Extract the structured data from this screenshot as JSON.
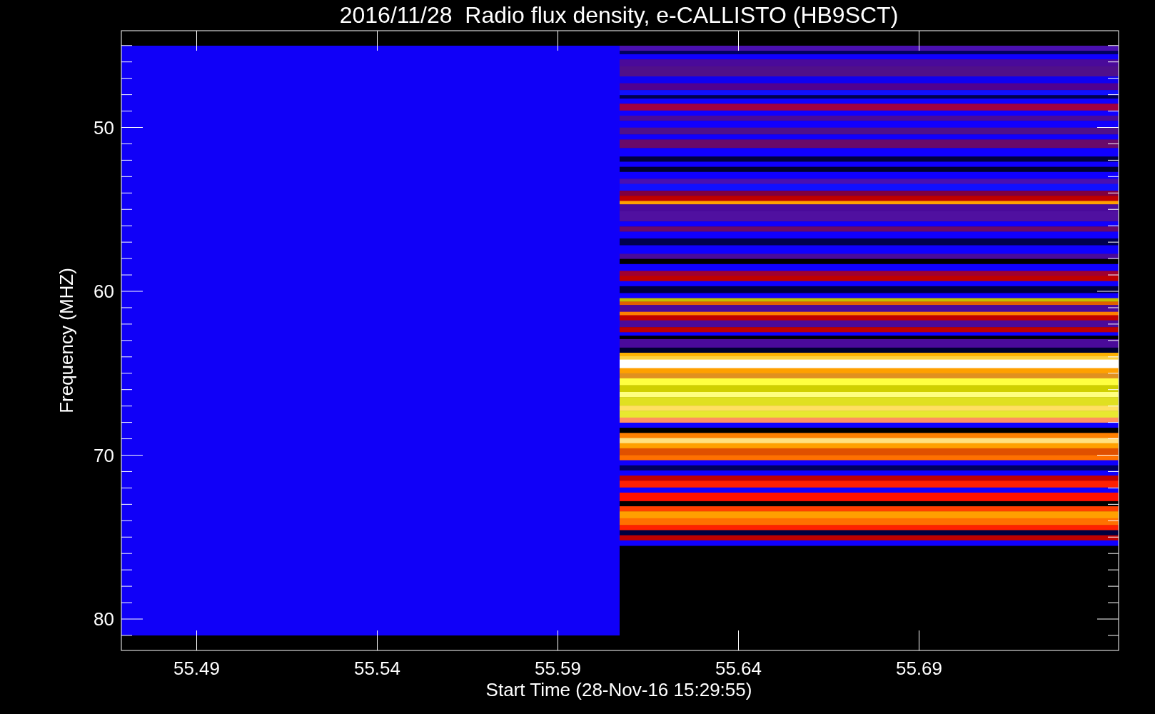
{
  "chart": {
    "title": "2016/11/28  Radio flux density, e-CALLISTO (HB9SCT)",
    "ylabel": "Frequency (MHZ)",
    "xlabel": "Start Time (28-Nov-16 15:29:55)",
    "yticks": [
      "50",
      "60",
      "70",
      "80"
    ],
    "xticks": [
      "55.49",
      "55.54",
      "55.59",
      "55.64",
      "55.69"
    ]
  }
}
